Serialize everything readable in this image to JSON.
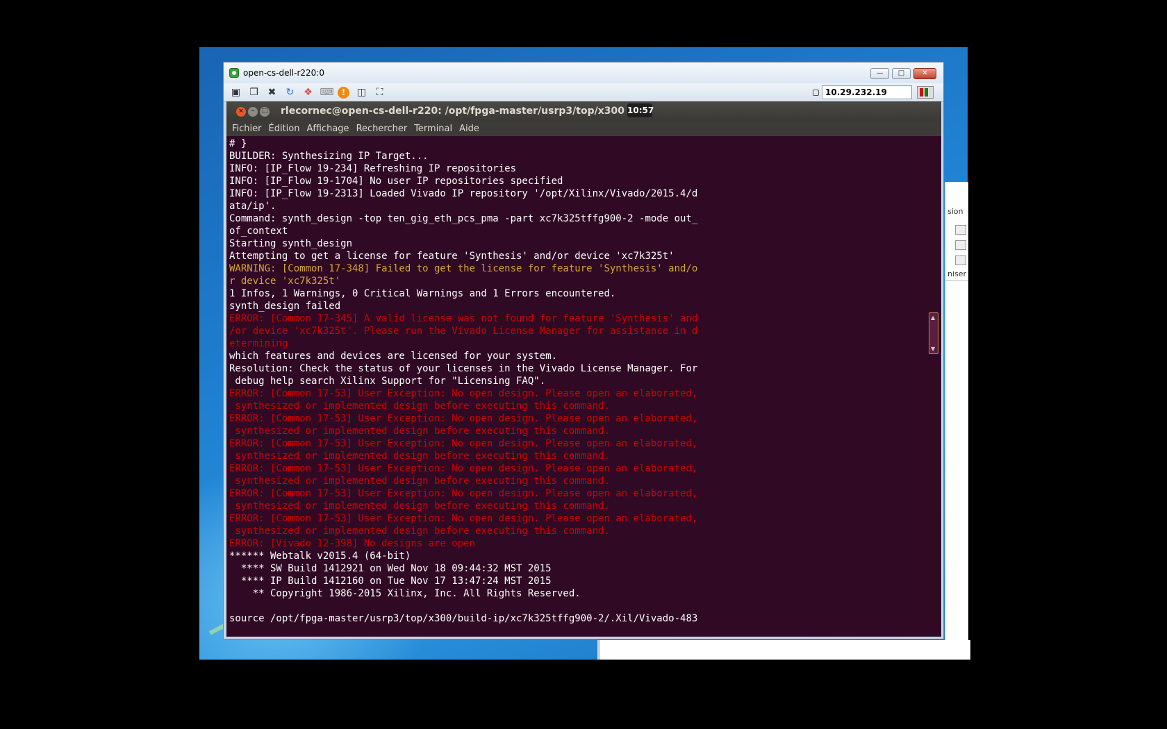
{
  "vnc": {
    "title": "open-cs-dell-r220:0",
    "address": "10.29.232.19",
    "window_buttons": [
      "minimize",
      "maximize",
      "close"
    ],
    "toolbar_icons": [
      "connection-info-icon",
      "options-icon",
      "tools-icon",
      "refresh-icon",
      "windows-logo-icon",
      "keyboard-icon",
      "alert-icon",
      "transfer-files-icon",
      "fullscreen-icon"
    ]
  },
  "background_window": {
    "label_top": "sion",
    "label_bottom": "niser"
  },
  "terminal": {
    "title": "rlecornec@open-cs-dell-r220: /opt/fpga-master/usrp3/top/x300",
    "clock": "10:57",
    "menu": [
      "Fichier",
      "Édition",
      "Affichage",
      "Rechercher",
      "Terminal",
      "Aide"
    ],
    "lines": [
      {
        "t": "# }",
        "k": "n"
      },
      {
        "t": "BUILDER: Synthesizing IP Target...",
        "k": "n"
      },
      {
        "t": "INFO: [IP_Flow 19-234] Refreshing IP repositories",
        "k": "n"
      },
      {
        "t": "INFO: [IP_Flow 19-1704] No user IP repositories specified",
        "k": "n"
      },
      {
        "t": "INFO: [IP_Flow 19-2313] Loaded Vivado IP repository '/opt/Xilinx/Vivado/2015.4/d",
        "k": "n"
      },
      {
        "t": "ata/ip'.",
        "k": "n"
      },
      {
        "t": "Command: synth_design -top ten_gig_eth_pcs_pma -part xc7k325tffg900-2 -mode out_",
        "k": "n"
      },
      {
        "t": "of_context",
        "k": "n"
      },
      {
        "t": "Starting synth_design",
        "k": "n"
      },
      {
        "t": "Attempting to get a license for feature 'Synthesis' and/or device 'xc7k325t'",
        "k": "n"
      },
      {
        "t": "WARNING: [Common 17-348] Failed to get the license for feature 'Synthesis' and/o",
        "k": "w"
      },
      {
        "t": "r device 'xc7k325t'",
        "k": "w"
      },
      {
        "t": "1 Infos, 1 Warnings, 0 Critical Warnings and 1 Errors encountered.",
        "k": "n"
      },
      {
        "t": "synth_design failed",
        "k": "n"
      },
      {
        "t": "ERROR: [Common 17-345] A valid license was not found for feature 'Synthesis' and",
        "k": "e"
      },
      {
        "t": "/or device 'xc7k325t'. Please run the Vivado License Manager for assistance in d",
        "k": "e"
      },
      {
        "t": "etermining",
        "k": "e"
      },
      {
        "t": "which features and devices are licensed for your system.",
        "k": "n"
      },
      {
        "t": "Resolution: Check the status of your licenses in the Vivado License Manager. For",
        "k": "n"
      },
      {
        "t": " debug help search Xilinx Support for \"Licensing FAQ\".",
        "k": "n"
      },
      {
        "t": "ERROR: [Common 17-53] User Exception: No open design. Please open an elaborated,",
        "k": "e"
      },
      {
        "t": " synthesized or implemented design before executing this command.",
        "k": "e"
      },
      {
        "t": "ERROR: [Common 17-53] User Exception: No open design. Please open an elaborated,",
        "k": "e"
      },
      {
        "t": " synthesized or implemented design before executing this command.",
        "k": "e"
      },
      {
        "t": "ERROR: [Common 17-53] User Exception: No open design. Please open an elaborated,",
        "k": "e"
      },
      {
        "t": " synthesized or implemented design before executing this command.",
        "k": "e"
      },
      {
        "t": "ERROR: [Common 17-53] User Exception: No open design. Please open an elaborated,",
        "k": "e"
      },
      {
        "t": " synthesized or implemented design before executing this command.",
        "k": "e"
      },
      {
        "t": "ERROR: [Common 17-53] User Exception: No open design. Please open an elaborated,",
        "k": "e"
      },
      {
        "t": " synthesized or implemented design before executing this command.",
        "k": "e"
      },
      {
        "t": "ERROR: [Common 17-53] User Exception: No open design. Please open an elaborated,",
        "k": "e"
      },
      {
        "t": " synthesized or implemented design before executing this command.",
        "k": "e"
      },
      {
        "t": "ERROR: [Vivado 12-398] No designs are open",
        "k": "e"
      },
      {
        "t": "****** Webtalk v2015.4 (64-bit)",
        "k": "n"
      },
      {
        "t": "  **** SW Build 1412921 on Wed Nov 18 09:44:32 MST 2015",
        "k": "n"
      },
      {
        "t": "  **** IP Build 1412160 on Tue Nov 17 13:47:24 MST 2015",
        "k": "n"
      },
      {
        "t": "    ** Copyright 1986-2015 Xilinx, Inc. All Rights Reserved.",
        "k": "n"
      },
      {
        "t": "",
        "k": "n"
      },
      {
        "t": "source /opt/fpga-master/usrp3/top/x300/build-ip/xc7k325tffg900-2/.Xil/Vivado-483",
        "k": "n"
      }
    ]
  },
  "colors": {
    "terminal_bg": "#300a24",
    "text_normal": "#ffffff",
    "text_warning": "#d6a53a",
    "text_error": "#cc0000"
  }
}
